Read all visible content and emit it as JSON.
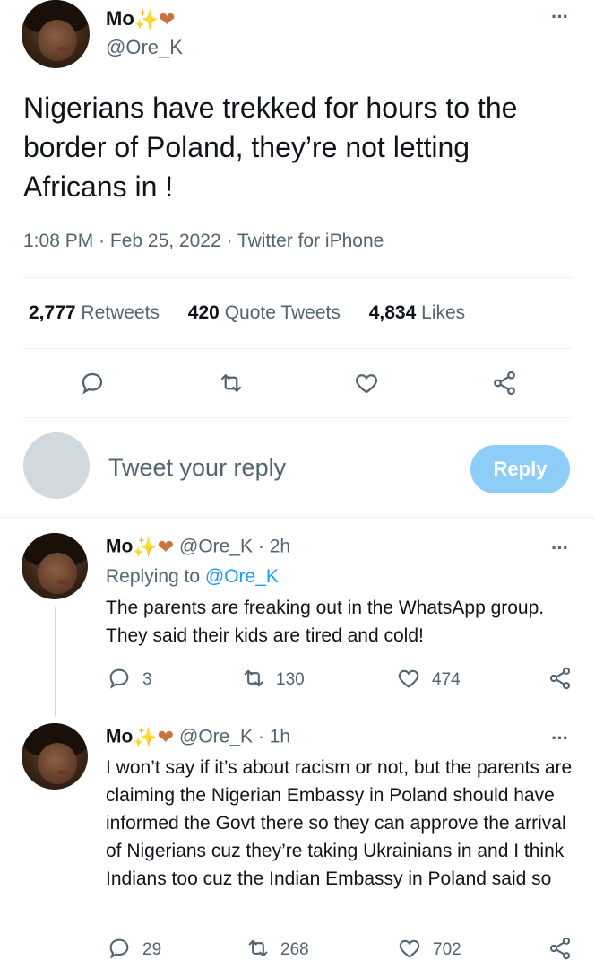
{
  "main_tweet": {
    "name": "Mo",
    "handle": "@Ore_K",
    "text": "Nigerians have trekked for hours to the border of Poland, they’re not letting Africans in !",
    "meta": "1:08 PM · Feb 25, 2022 · Twitter for iPhone",
    "stats": {
      "retweets_count": "2,777",
      "retweets_label": "Retweets",
      "quotes_count": "420",
      "quotes_label": "Quote Tweets",
      "likes_count": "4,834",
      "likes_label": "Likes"
    }
  },
  "composer": {
    "placeholder": "Tweet your reply",
    "button": "Reply"
  },
  "replies": [
    {
      "name": "Mo",
      "handle": "@Ore_K",
      "time": "· 2h",
      "replying_prefix": "Replying to",
      "replying_to": "@Ore_K",
      "text": "The parents are freaking out in the WhatsApp group. They said their kids are tired and cold!",
      "replies": "3",
      "retweets": "130",
      "likes": "474"
    },
    {
      "name": "Mo",
      "handle": "@Ore_K",
      "time": "· 1h",
      "text": "I won’t say if it’s about racism or not, but the parents are claiming the Nigerian Embassy in Poland should have informed the Govt there so they can approve the arrival of Nigerians cuz they’re taking Ukrainians in and I think Indians too cuz the Indian Embassy in Poland said so",
      "replies": "29",
      "retweets": "268",
      "likes": "702"
    }
  ],
  "icons": {
    "more": "more-icon",
    "reply": "reply-icon",
    "retweet": "retweet-icon",
    "like": "heart-icon",
    "share": "share-icon"
  },
  "colors": {
    "accent": "#1d9bf0",
    "reply_button_disabled": "#8ecdf8",
    "secondary_text": "#536471"
  }
}
